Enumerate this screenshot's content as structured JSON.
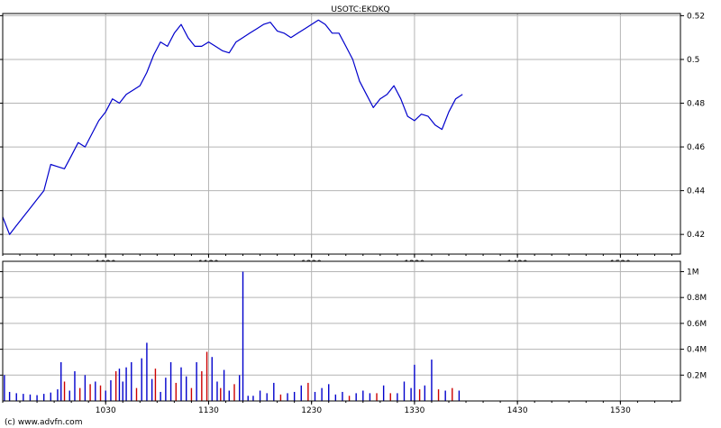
{
  "footer": {
    "credit": "(c) www.advfn.com"
  },
  "chart_data": [
    {
      "type": "line",
      "title": "USOTC:EKDKQ",
      "x_tick_labels": [
        "1030",
        "1130",
        "1230",
        "1330",
        "1430",
        "1530"
      ],
      "x_ticks": [
        630,
        690,
        750,
        810,
        870,
        930
      ],
      "xlim": [
        570,
        965
      ],
      "y_tick_labels": [
        "0.52",
        "0.5",
        "0.48",
        "0.46",
        "0.44",
        "0.42"
      ],
      "y_ticks": [
        0.52,
        0.5,
        0.48,
        0.46,
        0.44,
        0.42
      ],
      "ylim": [
        0.411,
        0.521
      ],
      "reference_line": {
        "value": 0.411,
        "color": "#cc0000"
      },
      "line_color": "#0000cc",
      "grid": true,
      "series": [
        {
          "x": [
            570,
            574,
            578,
            582,
            586,
            590,
            594,
            598,
            602,
            606,
            610,
            614,
            618,
            622,
            626,
            630,
            634,
            638,
            642,
            646,
            650,
            654,
            658,
            662,
            666,
            670,
            674,
            678,
            682,
            686,
            690,
            694,
            698,
            702,
            706,
            710,
            714,
            718,
            722,
            726,
            730,
            734,
            738,
            742,
            746,
            750,
            754,
            758,
            762,
            766,
            770,
            774,
            778,
            782,
            786,
            790,
            794,
            798,
            802,
            806,
            810,
            814,
            818,
            822,
            826,
            830,
            834,
            838
          ],
          "y": [
            0.428,
            0.42,
            0.424,
            0.428,
            0.432,
            0.436,
            0.44,
            0.452,
            0.451,
            0.45,
            0.456,
            0.462,
            0.46,
            0.466,
            0.472,
            0.476,
            0.482,
            0.48,
            0.484,
            0.486,
            0.488,
            0.494,
            0.502,
            0.508,
            0.506,
            0.512,
            0.516,
            0.51,
            0.506,
            0.506,
            0.508,
            0.506,
            0.504,
            0.503,
            0.508,
            0.51,
            0.512,
            0.514,
            0.516,
            0.517,
            0.513,
            0.512,
            0.51,
            0.512,
            0.514,
            0.516,
            0.518,
            0.516,
            0.512,
            0.512,
            0.506,
            0.5,
            0.49,
            0.484,
            0.478,
            0.482,
            0.484,
            0.488,
            0.482,
            0.474,
            0.472,
            0.475,
            0.474,
            0.47,
            0.468,
            0.476,
            0.482,
            0.484
          ]
        }
      ]
    },
    {
      "type": "bar",
      "x_tick_labels": [
        "1030",
        "1130",
        "1230",
        "1330",
        "1430",
        "1530"
      ],
      "x_ticks": [
        630,
        690,
        750,
        810,
        870,
        930
      ],
      "xlim": [
        570,
        965
      ],
      "y_tick_labels": [
        "1M",
        "0.8M",
        "0.6M",
        "0.4M",
        "0.2M"
      ],
      "y_ticks": [
        1000000,
        800000,
        600000,
        400000,
        200000
      ],
      "ylim": [
        0,
        1080000
      ],
      "grid": true,
      "colors": [
        "#0000cc",
        "#cc0000"
      ],
      "bars": {
        "x": [
          571,
          574,
          578,
          582,
          586,
          590,
          594,
          598,
          602,
          604,
          606,
          609,
          612,
          615,
          618,
          621,
          624,
          627,
          630,
          633,
          636,
          638,
          640,
          642,
          645,
          648,
          651,
          654,
          657,
          659,
          662,
          665,
          668,
          671,
          674,
          677,
          680,
          683,
          686,
          689,
          692,
          695,
          697,
          699,
          702,
          705,
          708,
          710,
          713,
          716,
          720,
          724,
          728,
          732,
          736,
          740,
          744,
          748,
          752,
          756,
          760,
          764,
          768,
          772,
          776,
          780,
          784,
          788,
          792,
          796,
          800,
          804,
          808,
          810,
          813,
          816,
          820,
          824,
          828,
          832,
          836
        ],
        "values": [
          200000,
          70000,
          60000,
          55000,
          50000,
          45000,
          55000,
          65000,
          90000,
          300000,
          150000,
          80000,
          230000,
          100000,
          200000,
          130000,
          150000,
          120000,
          80000,
          160000,
          230000,
          250000,
          150000,
          260000,
          300000,
          100000,
          330000,
          450000,
          170000,
          250000,
          70000,
          180000,
          300000,
          140000,
          260000,
          190000,
          100000,
          300000,
          230000,
          380000,
          340000,
          150000,
          100000,
          240000,
          80000,
          130000,
          200000,
          1000000,
          40000,
          40000,
          80000,
          60000,
          140000,
          50000,
          60000,
          70000,
          120000,
          140000,
          70000,
          100000,
          130000,
          50000,
          70000,
          40000,
          60000,
          80000,
          60000,
          60000,
          120000,
          60000,
          60000,
          150000,
          100000,
          280000,
          90000,
          120000,
          320000,
          90000,
          80000,
          100000,
          80000
        ],
        "series_index": [
          0,
          0,
          0,
          0,
          0,
          0,
          0,
          0,
          0,
          0,
          1,
          0,
          0,
          1,
          0,
          1,
          0,
          1,
          0,
          0,
          1,
          0,
          0,
          0,
          0,
          1,
          0,
          0,
          0,
          1,
          0,
          0,
          0,
          1,
          0,
          0,
          1,
          0,
          1,
          1,
          0,
          0,
          1,
          0,
          0,
          1,
          0,
          0,
          0,
          0,
          0,
          0,
          0,
          1,
          0,
          0,
          0,
          1,
          0,
          0,
          0,
          0,
          0,
          1,
          0,
          0,
          0,
          1,
          0,
          1,
          0,
          0,
          0,
          0,
          1,
          0,
          0,
          1,
          0,
          1,
          0
        ]
      }
    }
  ]
}
